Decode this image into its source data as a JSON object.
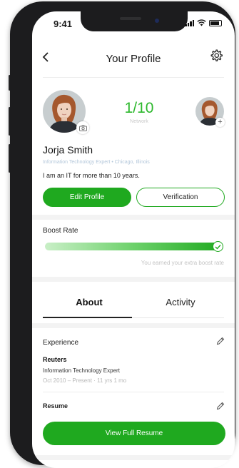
{
  "status_bar": {
    "time": "9:41"
  },
  "header": {
    "title": "Your Profile",
    "back_icon": "chevron-left-icon",
    "settings_icon": "gear-icon"
  },
  "profile": {
    "network_count": "1/10",
    "network_label": "Network",
    "name": "Jorja Smith",
    "meta": "Information Technology Expert  •  Chicago, Illinois",
    "bio": "I am an IT for more than 10 years.",
    "edit_label": "Edit Profile",
    "verification_label": "Verification"
  },
  "boost": {
    "title": "Boost Rate",
    "progress": 1.0,
    "note": "You earned your extra boost rate"
  },
  "tabs": [
    {
      "label": "About",
      "active": true
    },
    {
      "label": "Activity",
      "active": false
    }
  ],
  "experience": {
    "title": "Experience",
    "company": "Reuters",
    "role": "Information Technology Expert",
    "dates": "Oct 2010  –  Present  ·  11 yrs 1 mo"
  },
  "resume": {
    "title": "Resume",
    "button_label": "View Full Resume"
  },
  "colors": {
    "accent": "#1fa91f",
    "network_count": "#2db82d"
  }
}
